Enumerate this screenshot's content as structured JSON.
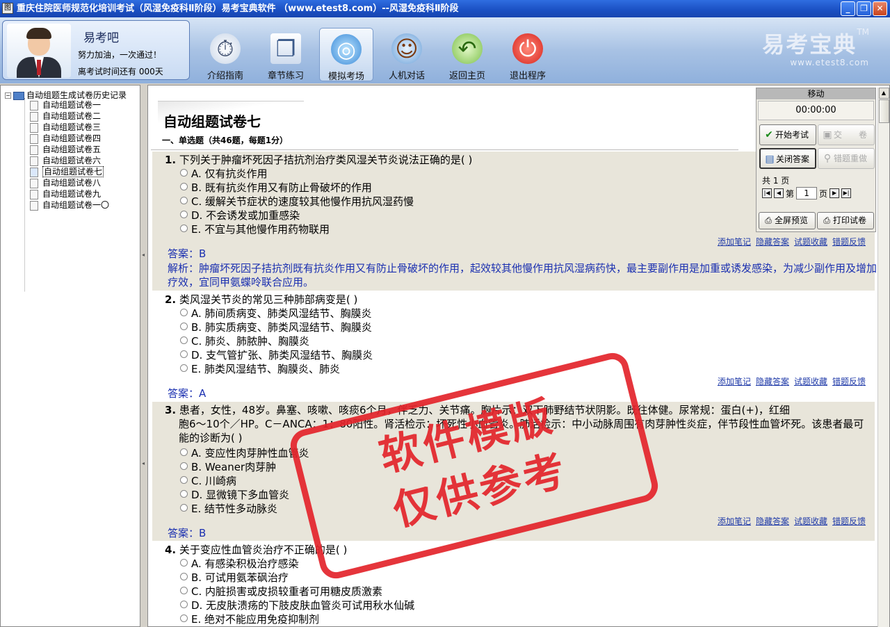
{
  "window": {
    "title": "重庆住院医师规范化培训考试（风湿免疫科Ⅱ阶段）易考宝典软件 （www.etest8.com）--风湿免疫科Ⅱ阶段",
    "app_icon": "图"
  },
  "user": {
    "name": "易考吧",
    "slogan": "努力加油，一次通过！",
    "countdown": "离考试时间还有 000天"
  },
  "toolbar": {
    "buttons": [
      {
        "label": "介绍指南",
        "icon": "stopwatch-icon",
        "glyph": "⏱"
      },
      {
        "label": "章节练习",
        "icon": "windows-icon",
        "glyph": "❐"
      },
      {
        "label": "模拟考场",
        "icon": "globe-computer-icon",
        "glyph": "◎"
      },
      {
        "label": "人机对话",
        "icon": "person-computer-icon",
        "glyph": "☺"
      },
      {
        "label": "返回主页",
        "icon": "back-arrow-icon",
        "glyph": "↶"
      },
      {
        "label": "退出程序",
        "icon": "power-icon",
        "glyph": "⏻"
      }
    ],
    "active_index": 2
  },
  "brand": {
    "logo": "易考宝典",
    "tm": "TM",
    "url": "www.etest8.com"
  },
  "tree": {
    "root": "自动组题生成试卷历史记录",
    "items": [
      "自动组题试卷一",
      "自动组题试卷二",
      "自动组题试卷三",
      "自动组题试卷四",
      "自动组题试卷五",
      "自动组题试卷六",
      "自动组题试卷七",
      "自动组题试卷八",
      "自动组题试卷九",
      "自动组题试卷一〇"
    ],
    "selected_index": 6
  },
  "paper": {
    "title": "自动组题试卷七",
    "section": "一、单选题（共46题，每题1分）"
  },
  "links": [
    "添加笔记",
    "隐藏答案",
    "试题收藏",
    "错题反馈"
  ],
  "questions": [
    {
      "number": "1.",
      "text": "下列关于肿瘤坏死因子拮抗剂治疗类风湿关节炎说法正确的是(  )",
      "options": [
        "A. 仅有抗炎作用",
        "B. 既有抗炎作用又有防止骨破坏的作用",
        "C. 缓解关节症状的速度较其他慢作用抗风湿药慢",
        "D. 不会诱发或加重感染",
        "E. 不宜与其他慢作用药物联用"
      ],
      "answer": "答案：B",
      "analysis": "解析：肿瘤坏死因子拮抗剂既有抗炎作用又有防止骨破坏的作用，起效较其他慢作用抗风湿病药快，最主要副作用是加重或诱发感染，为减少副作用及增加疗效，宜同甲氨蝶呤联合应用。"
    },
    {
      "number": "2.",
      "text": "类风湿关节炎的常见三种肺部病变是(  )",
      "options": [
        "A. 肺间质病变、肺类风湿结节、胸膜炎",
        "B. 肺实质病变、肺类风湿结节、胸膜炎",
        "C. 肺炎、肺脓肿、胸膜炎",
        "D. 支气管扩张、肺类风湿结节、胸膜炎",
        "E. 肺类风湿结节、胸膜炎、肺炎"
      ],
      "answer": "答案：A"
    },
    {
      "number": "3.",
      "text_l1": "患者，女性，48岁。鼻塞、咳嗽、咳痰6个月，伴乏力、关节痛。胸片示：双下肺野结节状阴影。既往体健。尿常规：蛋白(+)，红细",
      "text_l2": "胞6～10个／HP。C－ANCA：1：80阳性。肾活检示：坏死性小血管炎。肺活检示：中小动脉周围有肉芽肿性炎症，伴节段性血管坏死。该患者最可",
      "text_l3": "能的诊断为(  )",
      "options": [
        "A. 变应性肉芽肿性血管炎",
        "B. Weaner肉芽肿",
        "C. 川崎病",
        "D. 显微镜下多血管炎",
        "E. 结节性多动脉炎"
      ],
      "answer": "答案：B"
    },
    {
      "number": "4.",
      "text": "关于变应性血管炎治疗不正确的是(  )",
      "options": [
        "A. 有感染积极治疗感染",
        "B. 可试用氨苯砜治疗",
        "C. 内脏损害或皮损较重者可用糖皮质激素",
        "D. 无皮肤溃疡的下肢皮肤血管炎可试用秋水仙碱",
        "E. 绝对不能应用免疫抑制剂"
      ]
    }
  ],
  "sidepanel": {
    "header": "移动",
    "timer": "00:00:00",
    "start_exam": "开始考试",
    "submit": "交　　卷",
    "close_answer": "关闭答案",
    "redo_wrong": "错题重做",
    "page_count": "共 1 页",
    "page_prefix": "第",
    "page_value": "1",
    "page_suffix": "页",
    "fullscreen": "全屏预览",
    "print": "打印试卷"
  },
  "watermark": {
    "line1": "软件模版",
    "line2": "仅供参考"
  },
  "colors": {
    "accent": "#1a2fb0",
    "stamp": "#e3242b",
    "titlebar": "#2a5fd6"
  }
}
